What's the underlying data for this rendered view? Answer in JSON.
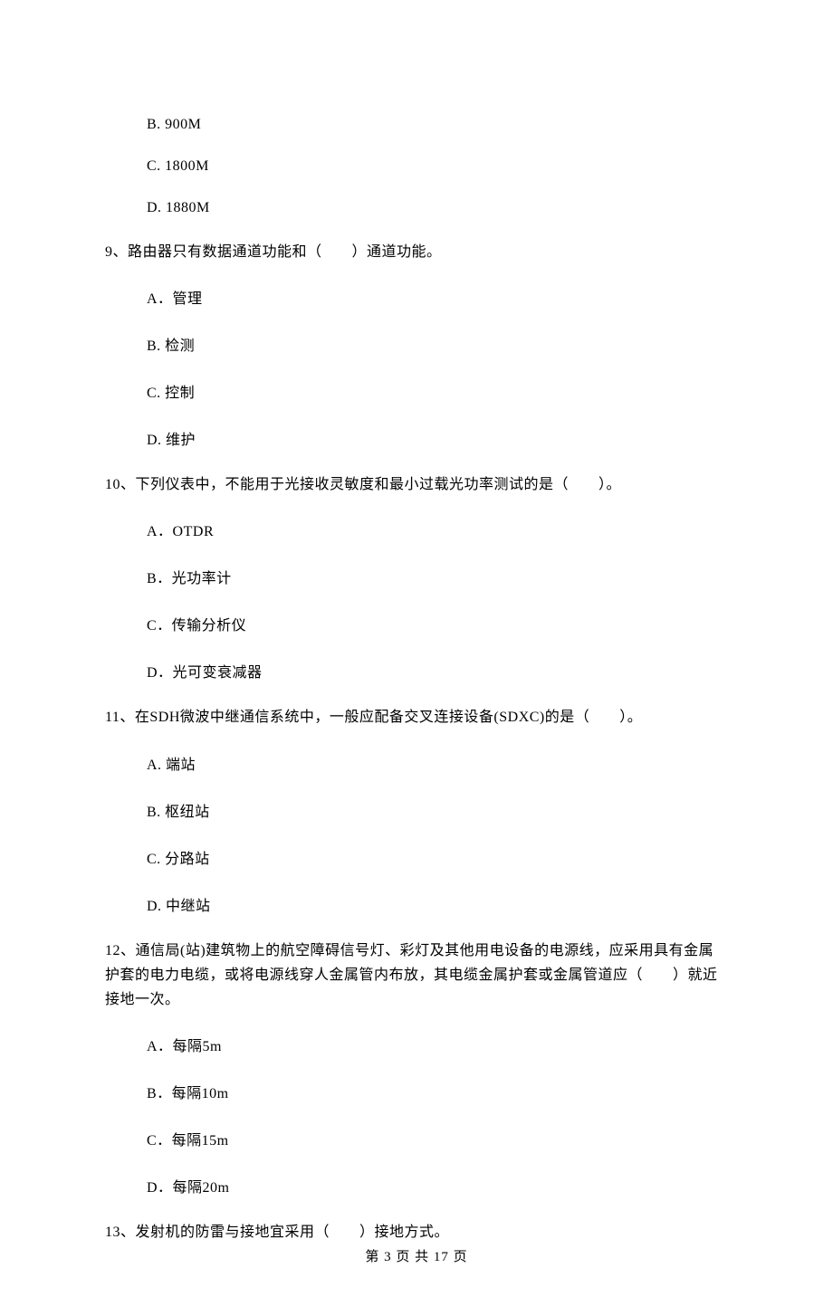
{
  "pre_options": [
    "B. 900M",
    "C. 1800M",
    "D. 1880M"
  ],
  "q9": {
    "text": "9、路由器只有数据通道功能和（　　）通道功能。",
    "options": [
      "A．管理",
      "B. 检测",
      "C. 控制",
      "D. 维护"
    ]
  },
  "q10": {
    "text": "10、下列仪表中，不能用于光接收灵敏度和最小过载光功率测试的是（　　）。",
    "options": [
      "A．OTDR",
      "B．光功率计",
      "C．传输分析仪",
      "D．光可变衰减器"
    ]
  },
  "q11": {
    "text": "11、在SDH微波中继通信系统中，一般应配备交叉连接设备(SDXC)的是（　　）。",
    "options": [
      "A. 端站",
      "B. 枢纽站",
      "C. 分路站",
      "D. 中继站"
    ]
  },
  "q12": {
    "text": "12、通信局(站)建筑物上的航空障碍信号灯、彩灯及其他用电设备的电源线，应采用具有金属护套的电力电缆，或将电源线穿人金属管内布放，其电缆金属护套或金属管道应（　　）就近接地一次。",
    "options": [
      "A．每隔5m",
      "B．每隔10m",
      "C．每隔15m",
      "D．每隔20m"
    ]
  },
  "q13": {
    "text": "13、发射机的防雷与接地宜采用（　　）接地方式。"
  },
  "footer": "第 3 页 共 17 页"
}
